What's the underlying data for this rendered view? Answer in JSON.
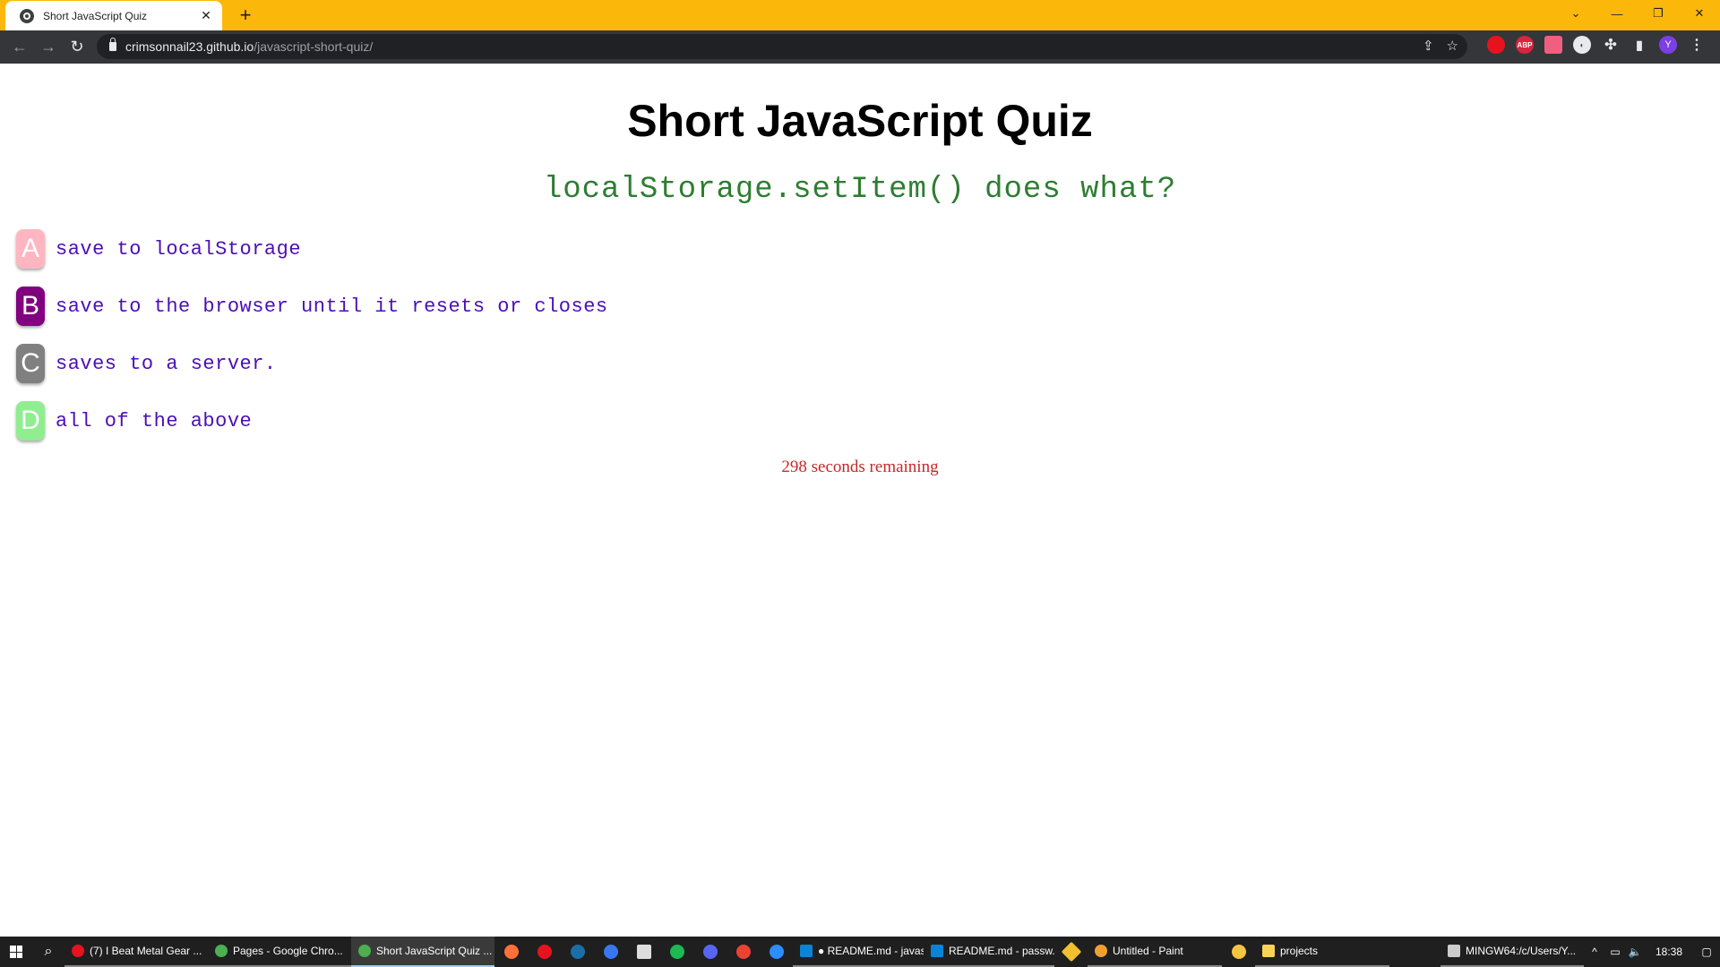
{
  "browser": {
    "tab_title": "Short JavaScript Quiz",
    "tab_close": "✕",
    "new_tab": "+",
    "url_host": "crimsonnail23.github.io",
    "url_path": "/javascript-short-quiz/",
    "profile_initial": "Y",
    "abp_label": "ABP"
  },
  "quiz": {
    "title": "Short JavaScript Quiz",
    "question": "localStorage.setItem() does what?",
    "answers": [
      {
        "letter": "A",
        "text": "save to localStorage",
        "color": "#ffb6c1"
      },
      {
        "letter": "B",
        "text": "save to the browser until it resets or closes",
        "color": "#800080"
      },
      {
        "letter": "C",
        "text": "saves to a server.",
        "color": "#808080"
      },
      {
        "letter": "D",
        "text": "all of the above",
        "color": "#90ee90"
      }
    ],
    "timer": "298 seconds remaining"
  },
  "taskbar": {
    "items": [
      {
        "label": "(7) I Beat Metal Gear ...",
        "icon_color": "#e8121e"
      },
      {
        "label": "Pages - Google Chro...",
        "icon_color": "#4caf50"
      },
      {
        "label": "Short JavaScript Quiz ...",
        "icon_color": "#4caf50"
      },
      {
        "label": "● README.md - javas...",
        "icon_color": "#0a84d6"
      },
      {
        "label": "README.md - passw...",
        "icon_color": "#0a84d6"
      },
      {
        "label": "Untitled - Paint",
        "icon_color": "#f0a030"
      },
      {
        "label": "projects",
        "icon_color": "#f7d358"
      },
      {
        "label": "MINGW64:/c/Users/Y...",
        "icon_color": "#cccccc"
      }
    ],
    "time": "18:38"
  },
  "colors": {
    "tabstrip": "#fbb80b",
    "question_text": "#2e7d32",
    "answer_text": "#4b0fb5",
    "timer_text": "#c62828"
  }
}
